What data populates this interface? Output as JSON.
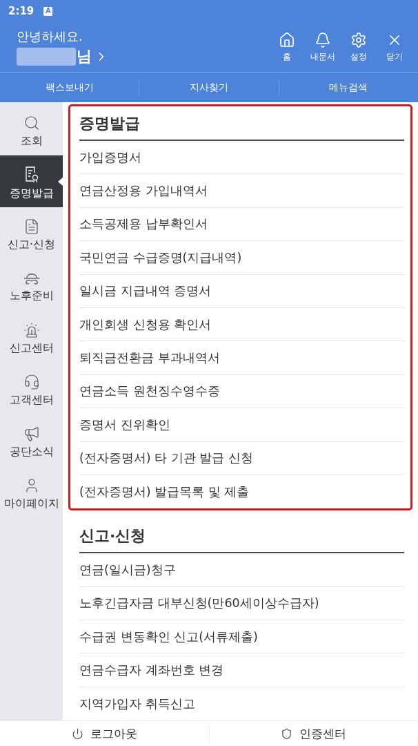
{
  "status_bar": {
    "time": "2:19",
    "notification_badge": "A"
  },
  "header": {
    "greeting": "안녕하세요.",
    "name_suffix": "님",
    "actions": [
      {
        "kind": "home",
        "label": "홈"
      },
      {
        "kind": "bell",
        "label": "내문서"
      },
      {
        "kind": "settings",
        "label": "설정"
      },
      {
        "kind": "close",
        "label": "닫기"
      }
    ]
  },
  "quick_tabs": [
    "팩스보내기",
    "지사찾기",
    "메뉴검색"
  ],
  "sidebar": {
    "items": [
      {
        "kind": "search",
        "label": "조회",
        "selected": false
      },
      {
        "kind": "certificate",
        "label": "증명발급",
        "selected": true
      },
      {
        "kind": "document",
        "label": "신고·신청",
        "selected": false
      },
      {
        "kind": "hat",
        "label": "노후준비",
        "selected": false
      },
      {
        "kind": "siren",
        "label": "신고센터",
        "selected": false
      },
      {
        "kind": "headset",
        "label": "고객센터",
        "selected": false
      },
      {
        "kind": "megaphone",
        "label": "공단소식",
        "selected": false
      },
      {
        "kind": "person",
        "label": "마이페이지",
        "selected": false
      }
    ]
  },
  "sections": [
    {
      "title": "증명발급",
      "highlighted": true,
      "items": [
        "가입증명서",
        "연금산정용 가입내역서",
        "소득공제용 납부확인서",
        "국민연금 수급증명(지급내역)",
        "일시금 지급내역 증명서",
        "개인회생 신청용 확인서",
        "퇴직금전환금 부과내역서",
        "연금소득 원천징수영수증",
        "증명서 진위확인",
        "(전자증명서) 타 기관 발급 신청",
        "(전자증명서) 발급목록 및 제출"
      ]
    },
    {
      "title": "신고·신청",
      "highlighted": false,
      "items": [
        "연금(일시금)청구",
        "노후긴급자금 대부신청(만60세이상수급자)",
        "수급권 변동확인 신고(서류제출)",
        "연금수급자 계좌번호 변경",
        "지역가입자 취득신고"
      ]
    }
  ],
  "bottom_bar": [
    {
      "kind": "power",
      "label": "로그아웃"
    },
    {
      "kind": "shield",
      "label": "인증센터"
    }
  ]
}
